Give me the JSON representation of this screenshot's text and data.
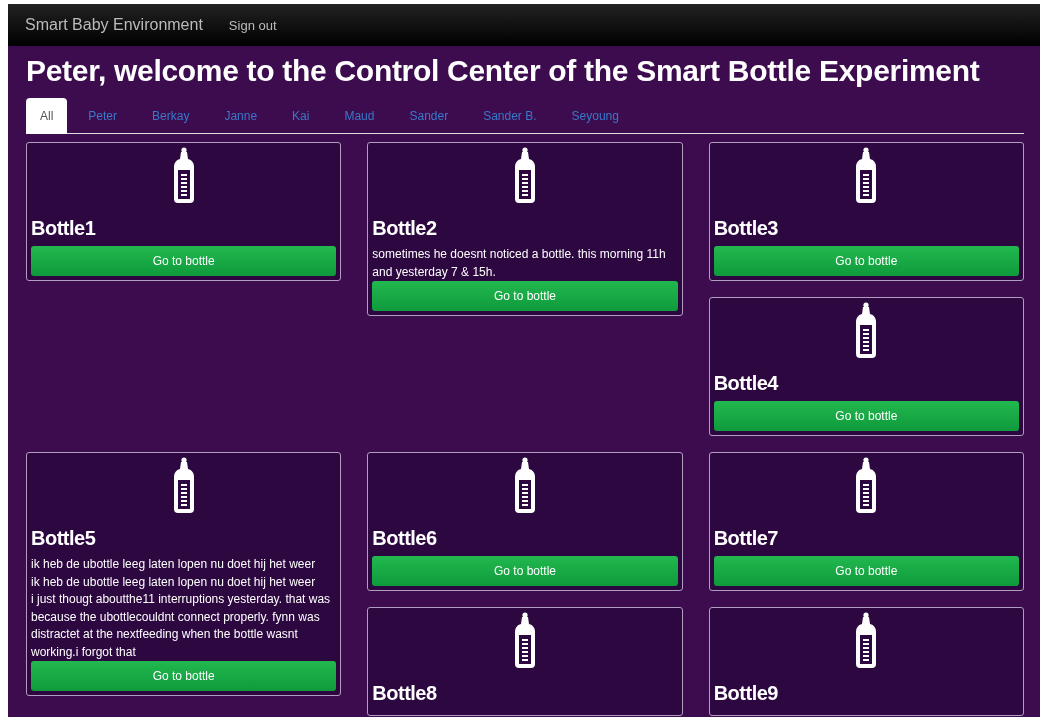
{
  "navbar": {
    "brand": "Smart Baby Environment",
    "links": [
      "Sign out"
    ]
  },
  "title": "Peter, welcome to the Control Center of the Smart Bottle Experiment",
  "tabs": [
    {
      "label": "All",
      "selected": true
    },
    {
      "label": "Peter",
      "selected": false
    },
    {
      "label": "Berkay",
      "selected": false
    },
    {
      "label": "Janne",
      "selected": false
    },
    {
      "label": "Kai",
      "selected": false
    },
    {
      "label": "Maud",
      "selected": false
    },
    {
      "label": "Sander",
      "selected": false
    },
    {
      "label": "Sander B.",
      "selected": false
    },
    {
      "label": "Seyoung",
      "selected": false
    }
  ],
  "bottles": [
    {
      "name": "Bottle1",
      "button": "Go to bottle"
    },
    {
      "name": "Bottle2",
      "notes": [
        "sometimes he doesnt noticed a bottle. this morning 11h and yesterday 7 & 15h."
      ],
      "button": "Go to bottle"
    },
    {
      "name": "Bottle3",
      "button": "Go to bottle"
    },
    {
      "name": "Bottle4",
      "button": "Go to bottle"
    },
    {
      "name": "Bottle5",
      "notes": [
        "ik heb de ubottle leeg laten lopen nu doet hij het weer",
        "ik heb de ubottle leeg laten lopen nu doet hij het weer",
        "i just thougt aboutthe11 interruptions yesterday. that was because the ubottlecouldnt connect properly. fynn was distractet at the nextfeeding when the bottle wasnt working.i forgot that"
      ],
      "button": "Go to bottle"
    },
    {
      "name": "Bottle6",
      "button": "Go to bottle"
    },
    {
      "name": "Bottle7",
      "button": "Go to bottle"
    },
    {
      "name": "Bottle8"
    },
    {
      "name": "Bottle9"
    }
  ]
}
